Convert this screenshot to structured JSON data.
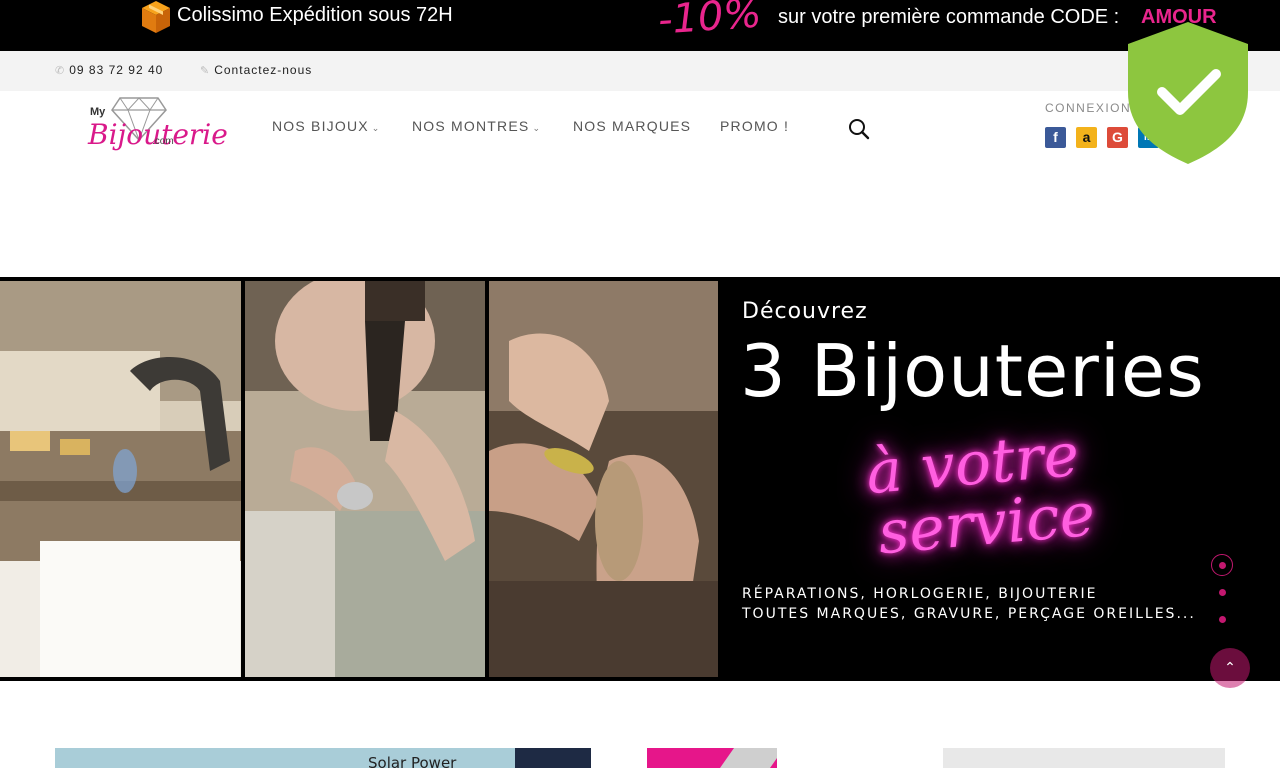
{
  "promo": {
    "shipping": "Colissimo Expédition sous 72H",
    "discount": "-10%",
    "text": "sur votre première commande CODE :",
    "code": "AMOUR"
  },
  "contact": {
    "phone": "09 83 72 92 40",
    "link": "Contactez-nous"
  },
  "logo": {
    "my": "My",
    "name": "Bijouterie",
    "com": ".com"
  },
  "nav": {
    "items": [
      {
        "label": "NOS BIJOUX",
        "has_dropdown": true
      },
      {
        "label": "NOS MONTRES",
        "has_dropdown": true
      },
      {
        "label": "NOS MARQUES",
        "has_dropdown": false
      },
      {
        "label": "PROMO !",
        "has_dropdown": false
      }
    ]
  },
  "login": {
    "label": "CONNEXION",
    "providers": [
      {
        "name": "facebook-icon",
        "glyph": "f",
        "color": "#3b5998"
      },
      {
        "name": "amazon-icon",
        "glyph": "a",
        "color": "#f3b21b"
      },
      {
        "name": "google-icon",
        "glyph": "G",
        "color": "#dd4b39"
      },
      {
        "name": "linkedin-icon",
        "glyph": "in",
        "color": "#0077b5"
      }
    ]
  },
  "hero": {
    "pre_title": "Découvrez",
    "title": "3 Bijouteries",
    "neon_line1": "à votre",
    "neon_line2": "service",
    "sub1": "RÉPARATIONS, HORLOGERIE, BIJOUTERIE",
    "sub2": "TOUTES MARQUES, GRAVURE, PERÇAGE OREILLES...",
    "slide_count": 3,
    "active_slide": 1
  },
  "products": {
    "solar": "Solar Power"
  },
  "colors": {
    "brand_pink": "#e9258d",
    "shield_green": "#8dc63f"
  }
}
